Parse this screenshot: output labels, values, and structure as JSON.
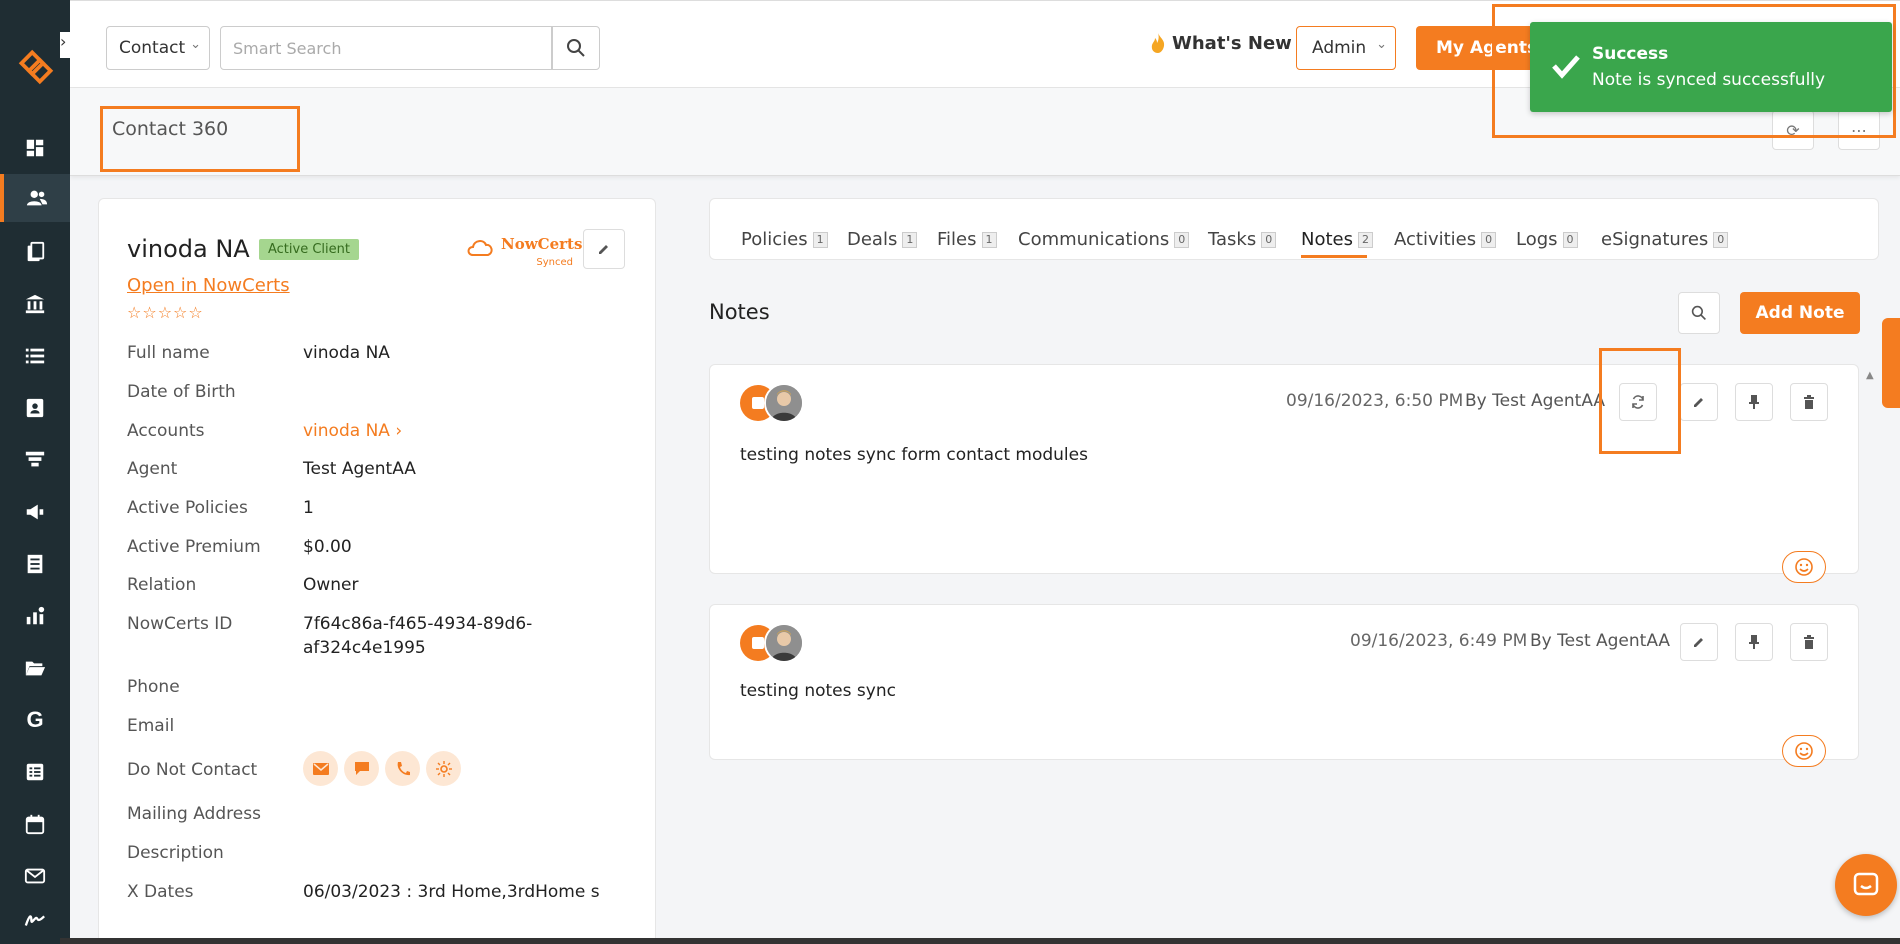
{
  "topbar": {
    "module_select": "Contact",
    "search_placeholder": "Smart Search",
    "whats_new": "What's New",
    "admin_label": "Admin",
    "my_agents": "My Agents"
  },
  "header": {
    "page_title": "Contact 360"
  },
  "toast": {
    "title": "Success",
    "message": "Note is synced successfully",
    "color": "#3aa64c"
  },
  "contact": {
    "name": "vinoda NA",
    "status": "Active Client",
    "integration_name": "NowCerts",
    "integration_status": "Synced",
    "open_link": "Open in NowCerts",
    "stars": "☆☆☆☆☆",
    "fields": [
      {
        "label": "Full name",
        "value": "vinoda NA"
      },
      {
        "label": "Date of Birth",
        "value": ""
      },
      {
        "label": "Accounts",
        "value": "vinoda NA ›"
      },
      {
        "label": "Agent",
        "value": "Test AgentAA"
      },
      {
        "label": "Active Policies",
        "value": "1"
      },
      {
        "label": "Active Premium",
        "value": "$0.00"
      },
      {
        "label": "Relation",
        "value": "Owner"
      },
      {
        "label": "NowCerts ID",
        "value": "7f64c86a-f465-4934-89d6-",
        "value2": "af324c4e1995"
      },
      {
        "label": "Phone",
        "value": ""
      },
      {
        "label": "Email",
        "value": ""
      },
      {
        "label": "Do Not Contact",
        "value": ""
      },
      {
        "label": "Mailing Address",
        "value": ""
      },
      {
        "label": "Description",
        "value": ""
      },
      {
        "label": "X Dates",
        "value": "06/03/2023 : 3rd Home,3rdHome s"
      }
    ]
  },
  "tabs": [
    {
      "label": "Policies",
      "count": "1"
    },
    {
      "label": "Deals",
      "count": "1"
    },
    {
      "label": "Files",
      "count": "1"
    },
    {
      "label": "Communications",
      "count": "0"
    },
    {
      "label": "Tasks",
      "count": "0"
    },
    {
      "label": "Notes",
      "count": "2"
    },
    {
      "label": "Activities",
      "count": "0"
    },
    {
      "label": "Logs",
      "count": "0"
    },
    {
      "label": "eSignatures",
      "count": "0"
    }
  ],
  "notes": {
    "section_title": "Notes",
    "add_button": "Add Note",
    "items": [
      {
        "timestamp": "09/16/2023, 6:50 PM",
        "author": "By Test AgentAA",
        "text": "testing notes sync form contact modules"
      },
      {
        "timestamp": "09/16/2023, 6:49 PM",
        "author": "By Test AgentAA",
        "text": "testing notes sync"
      }
    ]
  },
  "colors": {
    "accent": "#f47c20",
    "sidebar": "#1f2d33",
    "status_badge": "#a5d68f"
  }
}
